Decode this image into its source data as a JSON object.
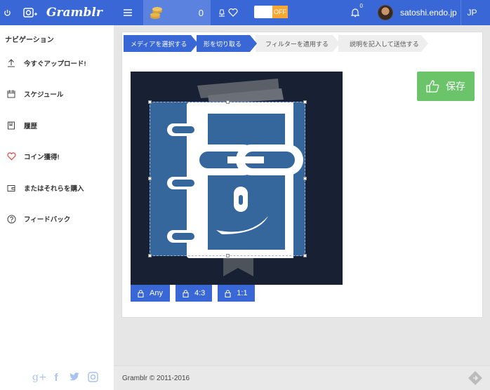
{
  "app": {
    "name": "Gramblr",
    "coins": "0",
    "toggle_label": "OFF",
    "notifications": "0",
    "username": "satoshi.endo.jp",
    "language": "JP"
  },
  "sidebar": {
    "title": "ナビゲーション",
    "items": [
      {
        "label": "今すぐアップロード!",
        "icon": "upload-icon"
      },
      {
        "label": "スケジュール",
        "icon": "calendar-icon"
      },
      {
        "label": "履歴",
        "icon": "history-icon"
      },
      {
        "label": "コイン獲得!",
        "icon": "heart-icon"
      },
      {
        "label": "またはそれらを購入",
        "icon": "wallet-icon"
      },
      {
        "label": "フィードバック",
        "icon": "help-icon"
      }
    ],
    "social": [
      "google-plus-icon",
      "facebook-icon",
      "twitter-icon",
      "instagram-icon"
    ]
  },
  "steps": [
    {
      "label": "メディアを選択する",
      "state": "active"
    },
    {
      "label": "形を切り取る",
      "state": "active"
    },
    {
      "label": "フィルターを適用する",
      "state": "inactive"
    },
    {
      "label": "説明を記入して送信する",
      "state": "inactive"
    }
  ],
  "crop_ratios": [
    "Any",
    "4:3",
    "1:1"
  ],
  "save_label": "保存",
  "footer": {
    "copyright": "Gramblr © 2011-2016"
  },
  "colors": {
    "primary": "#3a67d6",
    "save": "#6bc46a",
    "toggle_off": "#f7a734",
    "image_bg": "#172133",
    "logo_blue": "#35669c"
  }
}
